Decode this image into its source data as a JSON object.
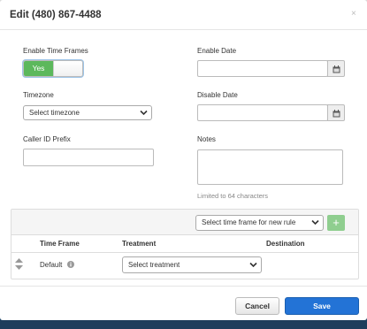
{
  "backdrop": {
    "text": "(480) 867-4488"
  },
  "modal": {
    "title": "Edit (480) 867-4488",
    "close": "×"
  },
  "form": {
    "enable_time_frames_label": "Enable Time Frames",
    "toggle_on_label": "Yes",
    "toggle_state": true,
    "timezone_label": "Timezone",
    "timezone_value": "Select timezone",
    "caller_id_label": "Caller ID Prefix",
    "caller_id_value": "",
    "enable_date_label": "Enable Date",
    "enable_date_value": "",
    "disable_date_label": "Disable Date",
    "disable_date_value": "",
    "notes_label": "Notes",
    "notes_value": "",
    "notes_hint": "Limited to 64 characters"
  },
  "rules": {
    "time_frame_select": "Select time frame for new rule",
    "add_button": "+",
    "columns": [
      "Time Frame",
      "Treatment",
      "Destination"
    ],
    "rows": [
      {
        "time_frame": "Default",
        "treatment": "Select treatment",
        "destination": ""
      }
    ]
  },
  "footer": {
    "cancel_label": "Cancel",
    "save_label": "Save"
  },
  "colors": {
    "toggle_on": "#5cb85c",
    "save_button": "#2373d6",
    "add_button": "#8fce8f",
    "backdrop": "#1d4466"
  }
}
